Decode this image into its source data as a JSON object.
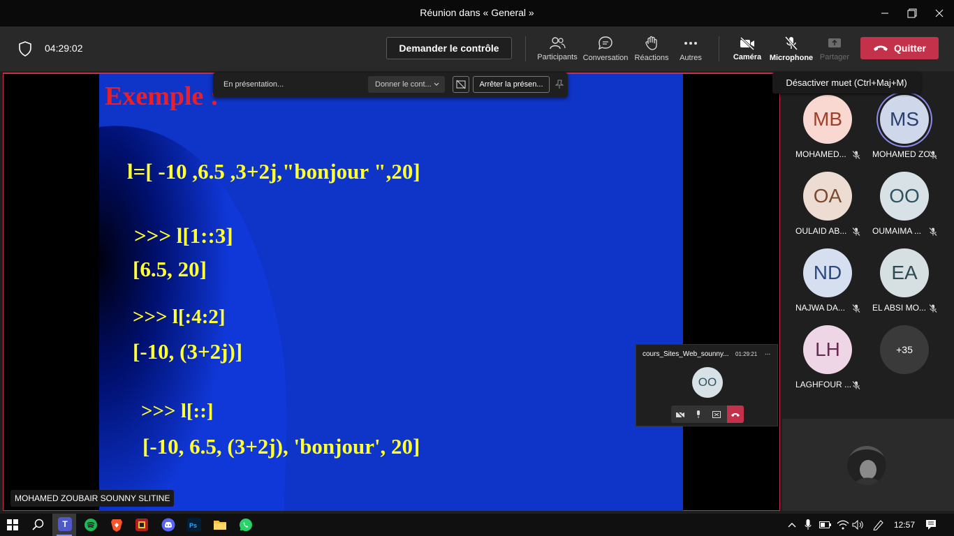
{
  "window": {
    "title": "Réunion dans « General »"
  },
  "toolbar": {
    "timer": "04:29:02",
    "request_control": "Demander le contrôle",
    "participants": "Participants",
    "conversation": "Conversation",
    "reactions": "Réactions",
    "more": "Autres",
    "camera": "Caméra",
    "microphone": "Microphone",
    "share": "Partager",
    "leave": "Quitter",
    "tooltip": "Désactiver muet (Ctrl+Maj+M)"
  },
  "presenting_bar": {
    "status": "En présentation...",
    "give_control": "Donner le cont...",
    "stop_presenting": "Arrêter la présen..."
  },
  "slide": {
    "title": "Exemple :",
    "line1": "l=[ -10 ,6.5 ,3+2j,\"bonjour \",20]",
    "line2": ">>> l[1::3]",
    "line3": "[6.5, 20]",
    "line4": ">>> l[:4:2]",
    "line5": "[-10, (3+2j)]",
    "line6": ">>> l[::]",
    "line7": "[-10, 6.5, (3+2j), 'bonjour', 20]"
  },
  "presenter_label": "MOHAMED ZOUBAIR SOUNNY SLITINE",
  "participants": [
    {
      "initials": "MB",
      "name": "MOHAMED...",
      "bg": "#f8d8d0",
      "fg": "#a0402a"
    },
    {
      "initials": "MS",
      "name": "MOHAMED ZO...",
      "bg": "#cfd8ea",
      "fg": "#2a3f6e"
    },
    {
      "initials": "OA",
      "name": "OULAID AB...",
      "bg": "#ecdcd2",
      "fg": "#7a4a30"
    },
    {
      "initials": "OO",
      "name": "OUMAIMA ...",
      "bg": "#d8e2e6",
      "fg": "#2e5460"
    },
    {
      "initials": "ND",
      "name": "NAJWA DA...",
      "bg": "#d6dff0",
      "fg": "#2a4a80"
    },
    {
      "initials": "EA",
      "name": "EL ABSI MO...",
      "bg": "#d6e0e2",
      "fg": "#2c4a50"
    },
    {
      "initials": "LH",
      "name": "LAGHFOUR ...",
      "bg": "#efd6e6",
      "fg": "#6a2a55"
    }
  ],
  "more_participants": "+35",
  "mini_window": {
    "title": "cours_Sites_Web_sounny...",
    "time": "01:29:21",
    "menu": "...",
    "initials": "OO"
  },
  "taskbar": {
    "clock": "12:57"
  }
}
